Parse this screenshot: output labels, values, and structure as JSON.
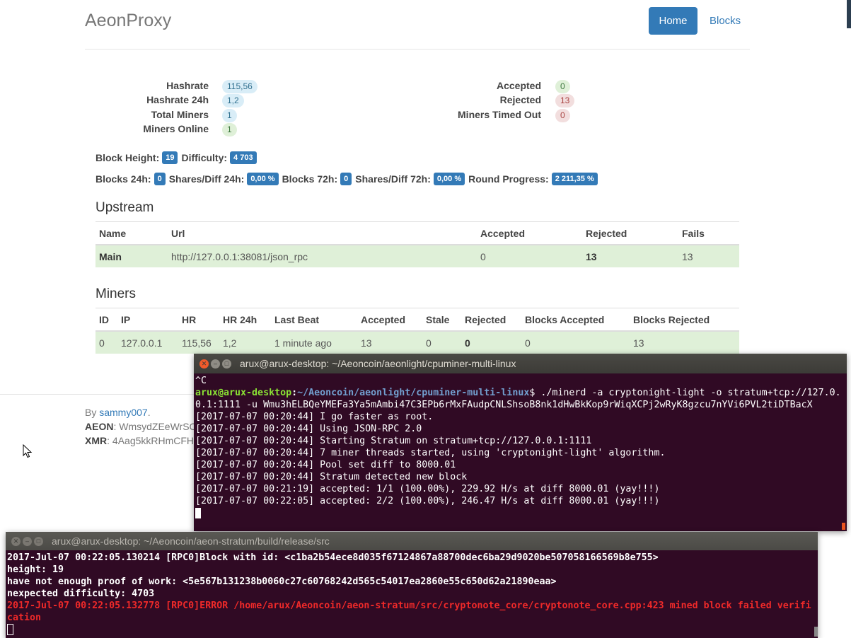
{
  "site": {
    "brand": "AeonProxy",
    "nav": {
      "home": "Home",
      "blocks": "Blocks"
    }
  },
  "stats_left": [
    {
      "label": "Hashrate",
      "value": "115,56",
      "color": "blue"
    },
    {
      "label": "Hashrate 24h",
      "value": "1,2",
      "color": "blue"
    },
    {
      "label": "Total Miners",
      "value": "1",
      "color": "blue"
    },
    {
      "label": "Miners Online",
      "value": "1",
      "color": "green"
    }
  ],
  "stats_right": [
    {
      "label": "Accepted",
      "value": "0",
      "color": "green"
    },
    {
      "label": "Rejected",
      "value": "13",
      "color": "red"
    },
    {
      "label": "Miners Timed Out",
      "value": "0",
      "color": "red"
    }
  ],
  "block_info": {
    "height_label": "Block Height:",
    "height": "19",
    "difficulty_label": "Difficulty:",
    "difficulty": "4 703"
  },
  "progress_info": {
    "blocks24_label": "Blocks 24h:",
    "blocks24": "0",
    "shares24_label": "Shares/Diff 24h:",
    "shares24": "0,00 %",
    "blocks72_label": "Blocks 72h:",
    "blocks72": "0",
    "shares72_label": "Shares/Diff 72h:",
    "shares72": "0,00 %",
    "round_label": "Round Progress:",
    "round": "2 211,35 %"
  },
  "upstream": {
    "title": "Upstream",
    "headers": {
      "name": "Name",
      "url": "Url",
      "accepted": "Accepted",
      "rejected": "Rejected",
      "fails": "Fails"
    },
    "row": {
      "name": "Main",
      "url": "http://127.0.0.1:38081/json_rpc",
      "accepted": "0",
      "rejected": "13",
      "fails": "13"
    }
  },
  "miners": {
    "title": "Miners",
    "headers": {
      "id": "ID",
      "ip": "IP",
      "hr": "HR",
      "hr24": "HR 24h",
      "last_beat": "Last Beat",
      "accepted": "Accepted",
      "stale": "Stale",
      "rejected": "Rejected",
      "blocks_accepted": "Blocks Accepted",
      "blocks_rejected": "Blocks Rejected"
    },
    "row": {
      "id": "0",
      "ip": "127.0.0.1",
      "hr": "115,56",
      "hr24": "1,2",
      "last_beat": "1 minute ago",
      "accepted": "13",
      "stale": "0",
      "rejected": "0",
      "blocks_accepted": "0",
      "blocks_rejected": "13"
    }
  },
  "footer": {
    "by": "By ",
    "author": "sammy007",
    "dot": ".",
    "aeon_label": "AEON",
    "aeon_addr": ": WmsydZEeWrSC",
    "xmr_label": "XMR",
    "xmr_addr": ": 4Aag5kkRHmCFH"
  },
  "terminal1": {
    "title": "arux@arux-desktop: ~/Aeoncoin/aeonlight/cpuminer-multi-linux",
    "line_ctrl_c": "^C",
    "prompt_user": "arux@arux-desktop",
    "prompt_sep": ":",
    "prompt_path": "~/Aeoncoin/aeonlight/cpuminer-multi-linux",
    "command": "$ ./minerd -a cryptonight-light -o stratum+tcp://127.0.0.1:1111 -u Wmu3hELBQeYMEFa3Ya5mAmbi47C3EPb6rMxFAudpCNLShsoB8nk1dHwBkKop9rWiqXCPj2wRyK8gzcu7nYVi6PVL2tiDTBacX",
    "log": [
      "[2017-07-07 00:20:44] I go faster as root.",
      "[2017-07-07 00:20:44] Using JSON-RPC 2.0",
      "[2017-07-07 00:20:44] Starting Stratum on stratum+tcp://127.0.0.1:1111",
      "[2017-07-07 00:20:44] 7 miner threads started, using 'cryptonight-light' algorithm.",
      "[2017-07-07 00:20:44] Pool set diff to 8000.01",
      "[2017-07-07 00:20:44] Stratum detected new block",
      "[2017-07-07 00:21:19] accepted: 1/1 (100.00%), 229.92 H/s at diff 8000.01 (yay!!!)",
      "[2017-07-07 00:22:05] accepted: 2/2 (100.00%), 246.47 H/s at diff 8000.01 (yay!!!)"
    ]
  },
  "terminal2": {
    "title": "arux@arux-desktop: ~/Aeoncoin/aeon-stratum/build/release/src",
    "lines": [
      "2017-Jul-07 00:22:05.130214 [RPC0]Block with id: <c1ba2b54ece8d035f67124867a88700dec6ba29d9020be507058166569b8e755>",
      "height: 19",
      "have not enough proof of work: <5e567b131238b0060c27c60768242d565c54017ea2860e55c650d62a21890eaa>",
      "nexpected difficulty: 4703"
    ],
    "error": "2017-Jul-07 00:22:05.132778 [RPC0]ERROR /home/arux/Aeoncoin/aeon-stratum/src/cryptonote_core/cryptonote_core.cpp:423 mined block failed verification"
  },
  "colors": {
    "primary": "#337ab7",
    "success_row": "#dff0d8",
    "terminal_bg": "#300a24",
    "prompt_green": "#8ae234",
    "prompt_blue": "#729fcf",
    "error_red": "#ef2929"
  }
}
